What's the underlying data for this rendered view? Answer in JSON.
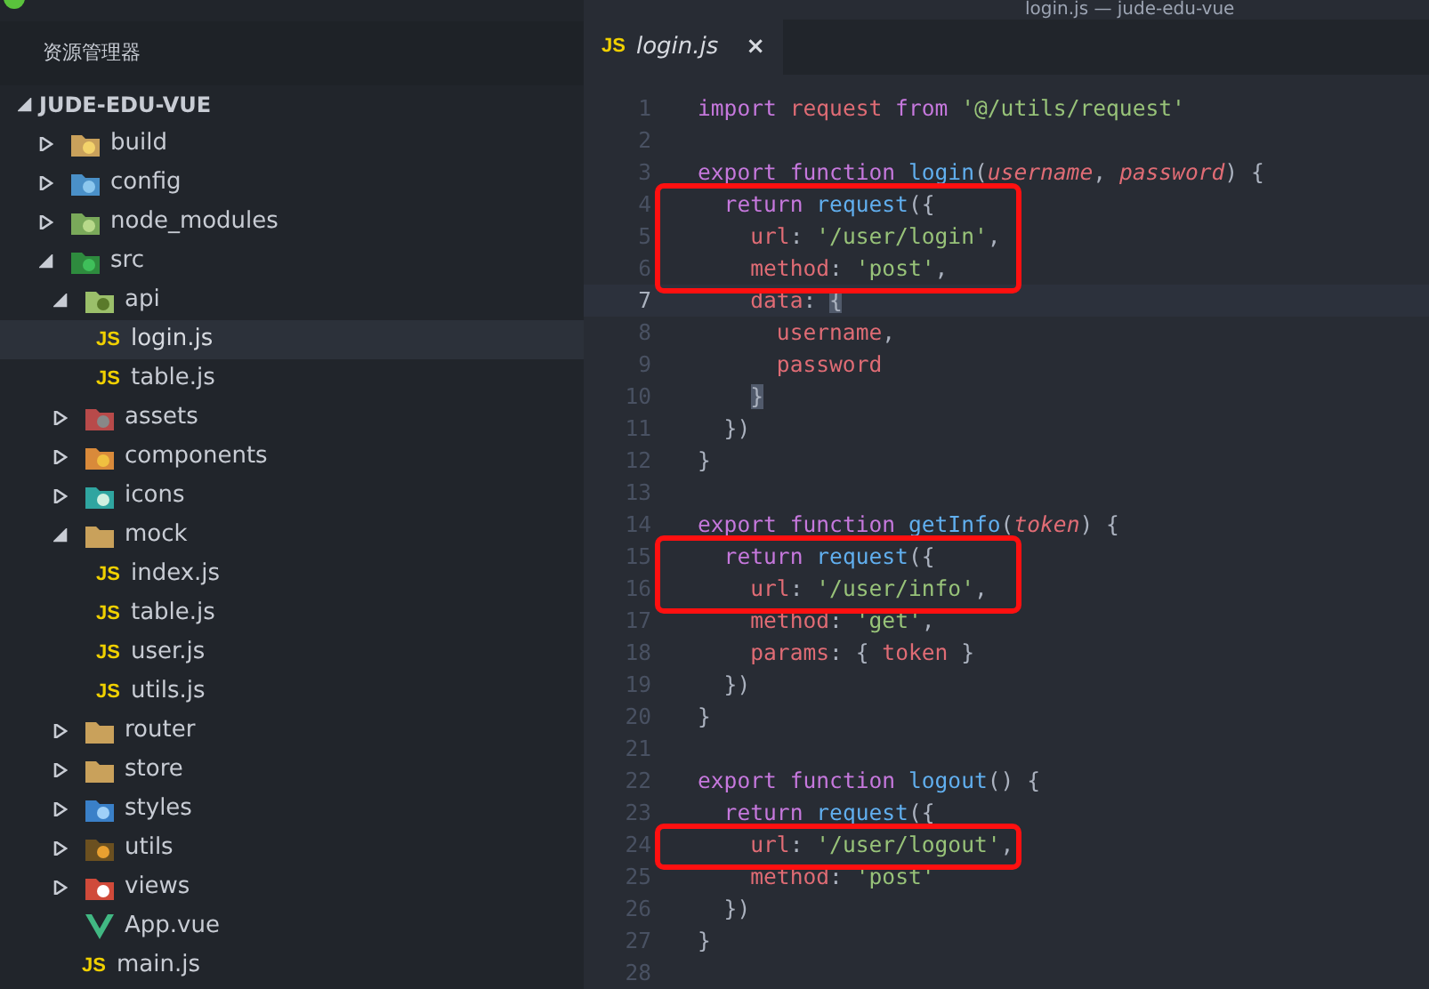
{
  "window": {
    "title": "login.js — jude-edu-vue"
  },
  "sidebar": {
    "title": "资源管理器",
    "project": {
      "name": "JUDE-EDU-VUE",
      "expanded": true
    },
    "tree": [
      {
        "name": "build",
        "kind": "folder",
        "expanded": false,
        "selected": false
      },
      {
        "name": "config",
        "kind": "folder",
        "expanded": false,
        "selected": false
      },
      {
        "name": "node_modules",
        "kind": "folder",
        "expanded": false,
        "selected": false
      },
      {
        "name": "src",
        "kind": "folder",
        "expanded": true,
        "selected": false,
        "children": [
          {
            "name": "api",
            "kind": "folder",
            "expanded": true,
            "selected": false,
            "children": [
              {
                "name": "login.js",
                "kind": "js-file",
                "badge": "JS",
                "selected": true
              },
              {
                "name": "table.js",
                "kind": "js-file",
                "badge": "JS",
                "selected": false
              }
            ]
          },
          {
            "name": "assets",
            "kind": "folder",
            "expanded": false,
            "selected": false
          },
          {
            "name": "components",
            "kind": "folder",
            "expanded": false,
            "selected": false
          },
          {
            "name": "icons",
            "kind": "folder",
            "expanded": false,
            "selected": false
          },
          {
            "name": "mock",
            "kind": "folder",
            "expanded": true,
            "selected": false,
            "children": [
              {
                "name": "index.js",
                "kind": "js-file",
                "badge": "JS",
                "selected": false
              },
              {
                "name": "table.js",
                "kind": "js-file",
                "badge": "JS",
                "selected": false
              },
              {
                "name": "user.js",
                "kind": "js-file",
                "badge": "JS",
                "selected": false
              },
              {
                "name": "utils.js",
                "kind": "js-file",
                "badge": "JS",
                "selected": false
              }
            ]
          },
          {
            "name": "router",
            "kind": "folder",
            "expanded": false,
            "selected": false
          },
          {
            "name": "store",
            "kind": "folder",
            "expanded": false,
            "selected": false
          },
          {
            "name": "styles",
            "kind": "folder",
            "expanded": false,
            "selected": false
          },
          {
            "name": "utils",
            "kind": "folder",
            "expanded": false,
            "selected": false
          },
          {
            "name": "views",
            "kind": "folder",
            "expanded": false,
            "selected": false
          },
          {
            "name": "App.vue",
            "kind": "vue-file",
            "selected": false
          },
          {
            "name": "main.js",
            "kind": "js-file",
            "badge": "JS",
            "selected": false
          }
        ]
      }
    ]
  },
  "tabs": [
    {
      "label": "login.js",
      "badge": "JS",
      "close": "×",
      "selected": true
    }
  ],
  "editor": {
    "lines": [
      {
        "number": "1",
        "tokens": [
          {
            "text": "import",
            "kind": "keyword"
          },
          {
            "text": " request",
            "kind": "var"
          },
          {
            "text": " from",
            "kind": "keyword"
          },
          {
            "text": " '@/utils/request'",
            "kind": "string"
          }
        ]
      },
      {
        "number": "2"
      },
      {
        "number": "3",
        "tokens": [
          {
            "text": "export",
            "kind": "keyword"
          },
          {
            "text": " function",
            "kind": "keyword"
          },
          {
            "text": " login",
            "kind": "func"
          },
          {
            "text": "(",
            "kind": "plain"
          },
          {
            "text": "username",
            "kind": "param"
          },
          {
            "text": ", ",
            "kind": "plain"
          },
          {
            "text": "password",
            "kind": "param"
          },
          {
            "text": ") {",
            "kind": "plain"
          }
        ]
      },
      {
        "number": "4",
        "boxed": true,
        "tokens": [
          {
            "text": "  return",
            "kind": "keyword"
          },
          {
            "text": " request",
            "kind": "func"
          },
          {
            "text": "({",
            "kind": "plain"
          }
        ]
      },
      {
        "number": "5",
        "boxed": true,
        "tokens": [
          {
            "text": "    url",
            "kind": "var"
          },
          {
            "text": ": ",
            "kind": "plain"
          },
          {
            "text": "'/user/login'",
            "kind": "string"
          },
          {
            "text": ",",
            "kind": "plain"
          }
        ]
      },
      {
        "number": "6",
        "boxed": true,
        "tokens": [
          {
            "text": "    method",
            "kind": "var"
          },
          {
            "text": ": ",
            "kind": "plain"
          },
          {
            "text": "'post'",
            "kind": "string"
          },
          {
            "text": ",",
            "kind": "plain"
          }
        ]
      },
      {
        "number": "7",
        "current": true,
        "tokens": [
          {
            "text": "    data",
            "kind": "var"
          },
          {
            "text": ": ",
            "kind": "plain"
          },
          {
            "text": "{",
            "kind": "match"
          }
        ]
      },
      {
        "number": "8",
        "tokens": [
          {
            "text": "      username",
            "kind": "var"
          },
          {
            "text": ",",
            "kind": "plain"
          }
        ]
      },
      {
        "number": "9",
        "tokens": [
          {
            "text": "      password",
            "kind": "var"
          }
        ]
      },
      {
        "number": "10",
        "tokens": [
          {
            "text": "    }",
            "kind": "match"
          }
        ]
      },
      {
        "number": "11",
        "tokens": [
          {
            "text": "  })",
            "kind": "plain"
          }
        ]
      },
      {
        "number": "12",
        "tokens": [
          {
            "text": "}",
            "kind": "plain"
          }
        ]
      },
      {
        "number": "13"
      },
      {
        "number": "14",
        "tokens": [
          {
            "text": "export",
            "kind": "keyword"
          },
          {
            "text": " function",
            "kind": "keyword"
          },
          {
            "text": " getInfo",
            "kind": "func"
          },
          {
            "text": "(",
            "kind": "plain"
          },
          {
            "text": "token",
            "kind": "param"
          },
          {
            "text": ") {",
            "kind": "plain"
          }
        ]
      },
      {
        "number": "15",
        "boxed": true,
        "tokens": [
          {
            "text": "  return",
            "kind": "keyword"
          },
          {
            "text": " request",
            "kind": "func"
          },
          {
            "text": "({",
            "kind": "plain"
          }
        ]
      },
      {
        "number": "16",
        "boxed": true,
        "tokens": [
          {
            "text": "    url",
            "kind": "var"
          },
          {
            "text": ": ",
            "kind": "plain"
          },
          {
            "text": "'/user/info'",
            "kind": "string"
          },
          {
            "text": ",",
            "kind": "plain"
          }
        ]
      },
      {
        "number": "17",
        "tokens": [
          {
            "text": "    method",
            "kind": "var"
          },
          {
            "text": ": ",
            "kind": "plain"
          },
          {
            "text": "'get'",
            "kind": "string"
          },
          {
            "text": ",",
            "kind": "plain"
          }
        ]
      },
      {
        "number": "18",
        "tokens": [
          {
            "text": "    params",
            "kind": "var"
          },
          {
            "text": ": { ",
            "kind": "plain"
          },
          {
            "text": "token",
            "kind": "var"
          },
          {
            "text": " }",
            "kind": "plain"
          }
        ]
      },
      {
        "number": "19",
        "tokens": [
          {
            "text": "  })",
            "kind": "plain"
          }
        ]
      },
      {
        "number": "20",
        "tokens": [
          {
            "text": "}",
            "kind": "plain"
          }
        ]
      },
      {
        "number": "21"
      },
      {
        "number": "22",
        "tokens": [
          {
            "text": "export",
            "kind": "keyword"
          },
          {
            "text": " function",
            "kind": "keyword"
          },
          {
            "text": " logout",
            "kind": "func"
          },
          {
            "text": "() {",
            "kind": "plain"
          }
        ]
      },
      {
        "number": "23",
        "tokens": [
          {
            "text": "  return",
            "kind": "keyword"
          },
          {
            "text": " request",
            "kind": "func"
          },
          {
            "text": "({",
            "kind": "plain"
          }
        ]
      },
      {
        "number": "24",
        "boxed": true,
        "tokens": [
          {
            "text": "    url",
            "kind": "var"
          },
          {
            "text": ": ",
            "kind": "plain"
          },
          {
            "text": "'/user/logout'",
            "kind": "string"
          },
          {
            "text": ",",
            "kind": "plain"
          }
        ]
      },
      {
        "number": "25",
        "tokens": [
          {
            "text": "    method",
            "kind": "var"
          },
          {
            "text": ": ",
            "kind": "plain"
          },
          {
            "text": "'post'",
            "kind": "string"
          }
        ]
      },
      {
        "number": "26",
        "tokens": [
          {
            "text": "  })",
            "kind": "plain"
          }
        ]
      },
      {
        "number": "27",
        "tokens": [
          {
            "text": "}",
            "kind": "plain"
          }
        ]
      },
      {
        "number": "28"
      }
    ]
  }
}
